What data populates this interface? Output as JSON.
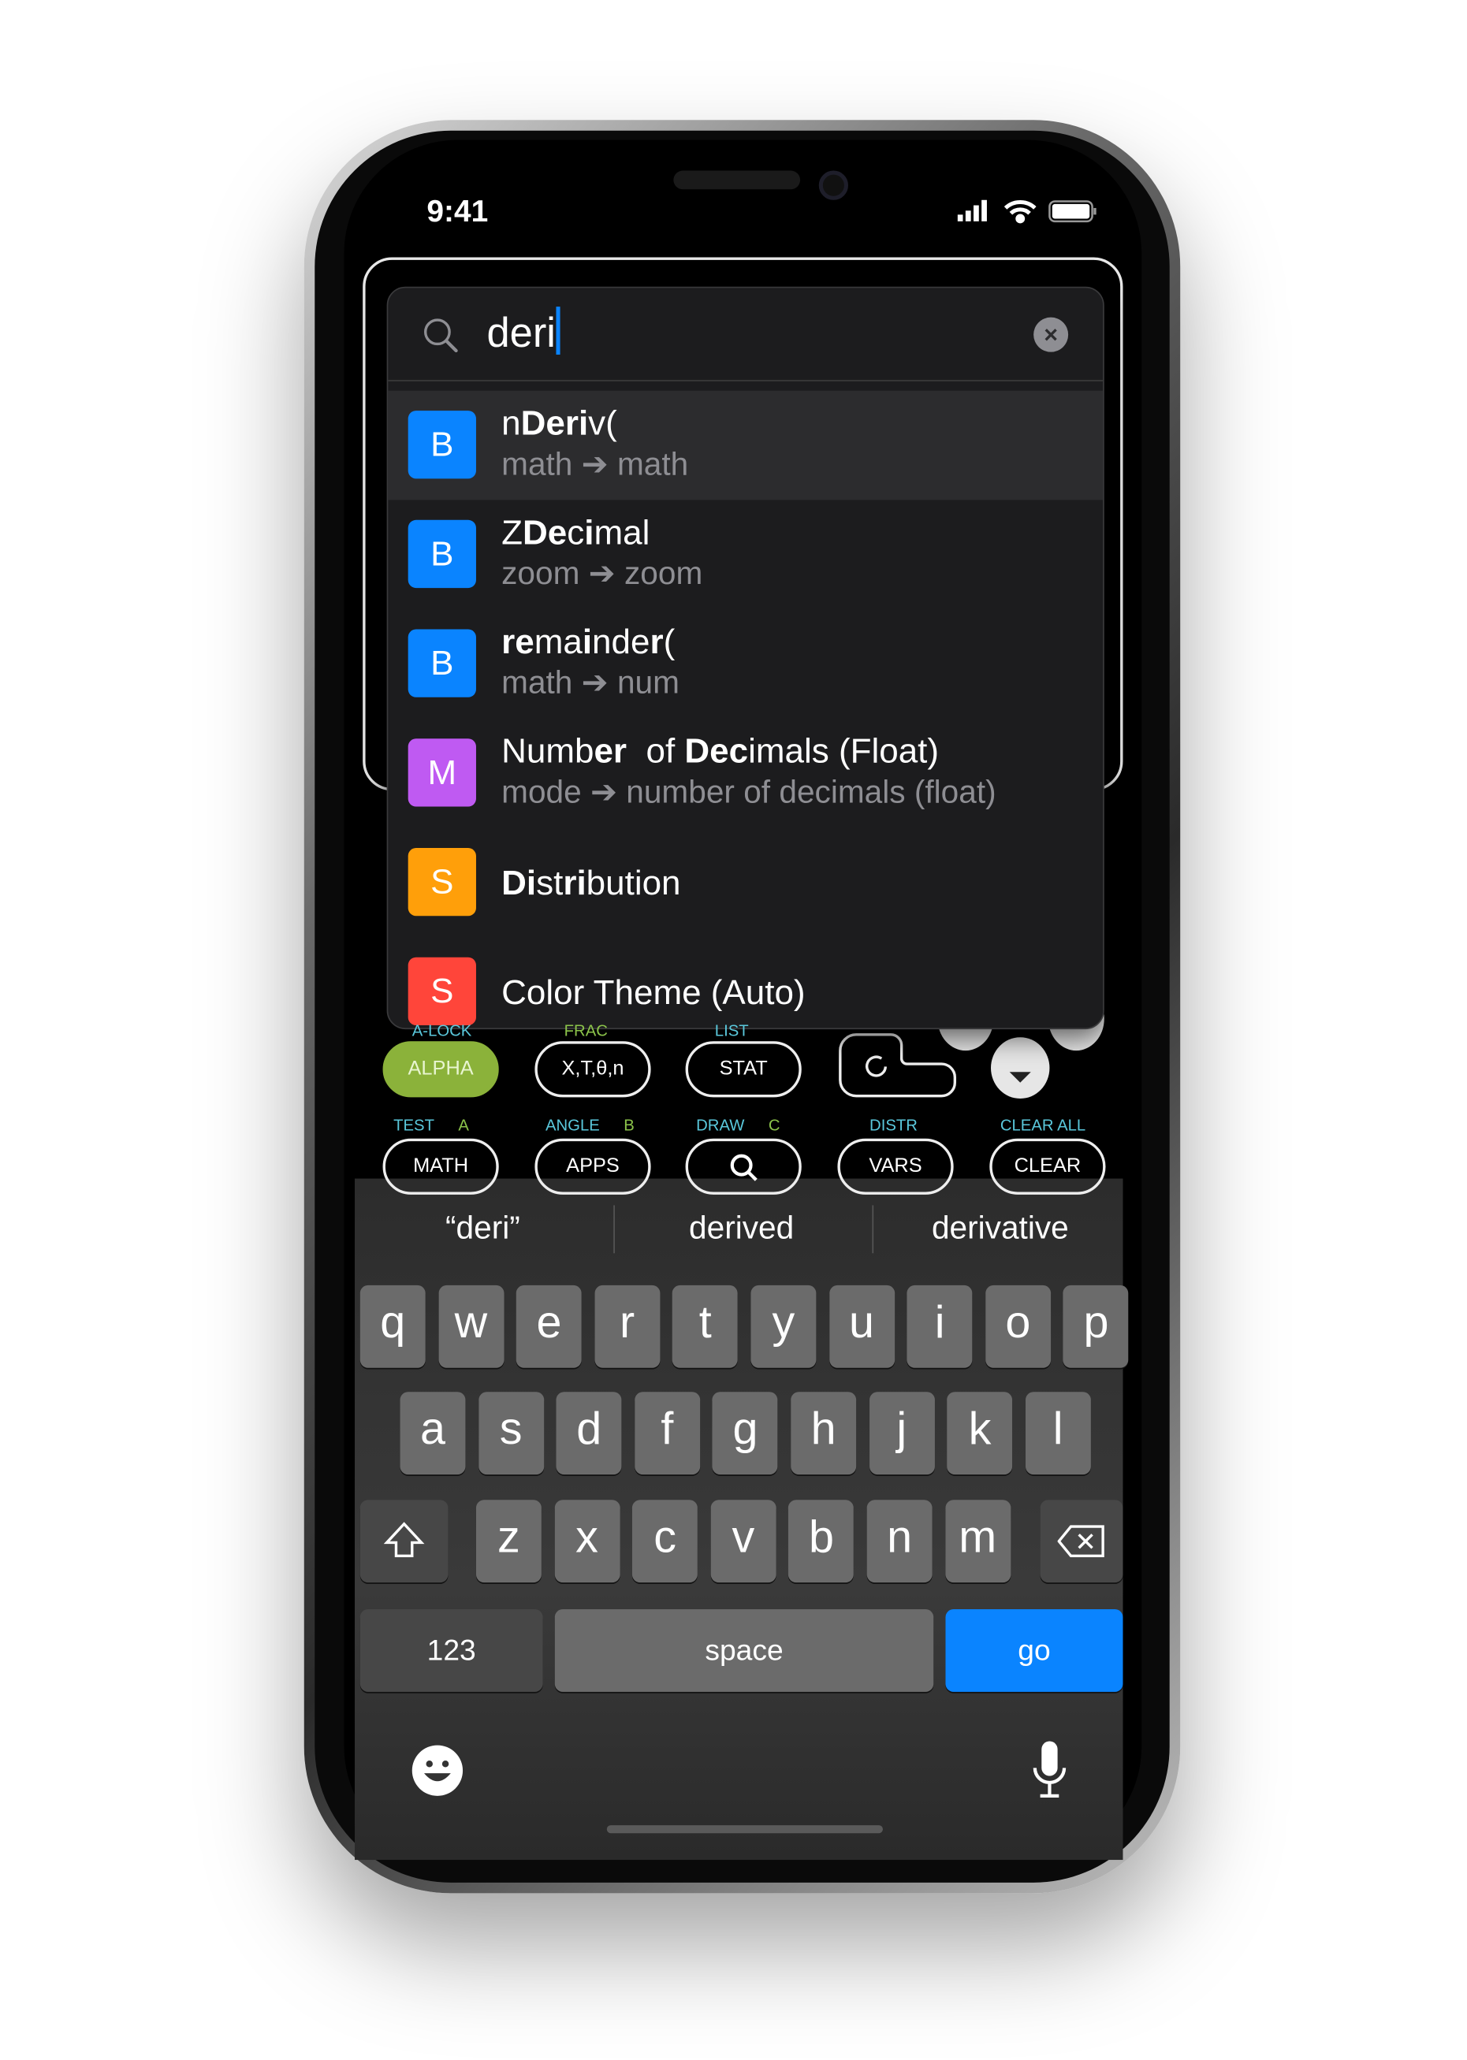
{
  "status": {
    "time": "9:41",
    "icons": [
      "cellular-icon",
      "wifi-icon",
      "battery-icon"
    ]
  },
  "search": {
    "query": "deri",
    "icon": "search-icon",
    "clear_icon": "clear-icon"
  },
  "results": [
    {
      "badge": "B",
      "color": "#0a84ff",
      "title_parts": [
        [
          "n",
          false
        ],
        [
          "Deri",
          true
        ],
        [
          "v(",
          false
        ]
      ],
      "subtitle": "math ➔ math",
      "selected": true
    },
    {
      "badge": "B",
      "color": "#0a84ff",
      "title_parts": [
        [
          "Z",
          false
        ],
        [
          "De",
          true
        ],
        [
          "c",
          false
        ],
        [
          "i",
          true
        ],
        [
          "mal",
          false
        ]
      ],
      "subtitle": "zoom ➔ zoom"
    },
    {
      "badge": "B",
      "color": "#0a84ff",
      "title_parts": [
        [
          "re",
          true
        ],
        [
          "ma",
          false
        ],
        [
          "i",
          true
        ],
        [
          "nde",
          false
        ],
        [
          "r",
          true
        ],
        [
          "(",
          false
        ]
      ],
      "subtitle": "math ➔ num"
    },
    {
      "badge": "M",
      "color": "#bf5af2",
      "title_parts": [
        [
          "Numb",
          false
        ],
        [
          "er",
          true
        ],
        [
          "  of ",
          false
        ],
        [
          "Dec",
          true
        ],
        [
          "imals (Float)",
          false
        ]
      ],
      "subtitle": "mode ➔ number of decimals (float)"
    },
    {
      "badge": "S",
      "color": "#ff9f0a",
      "title_parts": [
        [
          "Di",
          true
        ],
        [
          "st",
          false
        ],
        [
          "ri",
          true
        ],
        [
          "bution",
          false
        ]
      ],
      "subtitle": ""
    },
    {
      "badge": "S",
      "color": "#ff453a",
      "title_parts": [
        [
          "Color Theme (Auto)",
          false
        ]
      ],
      "subtitle": ""
    }
  ],
  "calc": {
    "row1_labels": [
      "A-LOCK",
      "FRAC",
      "LIST"
    ],
    "row1": [
      "ALPHA",
      "X,T,θ,n",
      "STAT"
    ],
    "row2_labels": [
      [
        "TEST",
        "A"
      ],
      [
        "ANGLE",
        "B"
      ],
      [
        "DRAW",
        "C"
      ],
      [
        "DISTR",
        ""
      ],
      [
        "CLEAR ALL",
        ""
      ]
    ],
    "row2": [
      "MATH",
      "APPS",
      "",
      "VARS",
      "CLEAR"
    ],
    "alpha_color": "#8bb23a"
  },
  "keyboard": {
    "suggestions": [
      "“deri”",
      "derived",
      "derivative"
    ],
    "row1": [
      "q",
      "w",
      "e",
      "r",
      "t",
      "y",
      "u",
      "i",
      "o",
      "p"
    ],
    "row2": [
      "a",
      "s",
      "d",
      "f",
      "g",
      "h",
      "j",
      "k",
      "l"
    ],
    "row3": [
      "z",
      "x",
      "c",
      "v",
      "b",
      "n",
      "m"
    ],
    "numbers": "123",
    "space": "space",
    "go": "go",
    "go_color": "#0a84ff"
  }
}
